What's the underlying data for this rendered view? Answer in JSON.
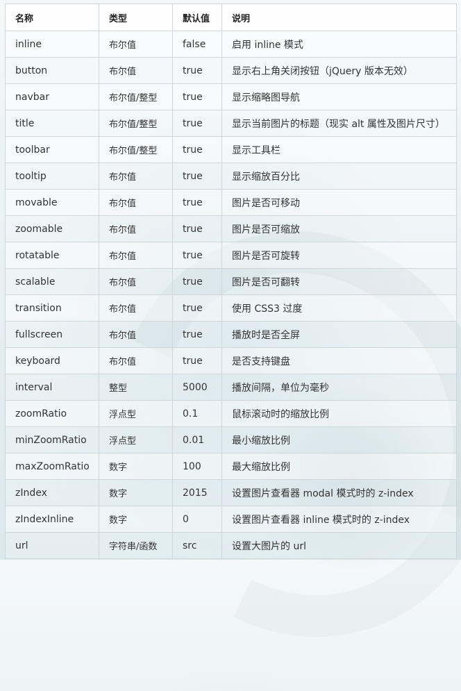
{
  "table": {
    "headers": [
      "名称",
      "类型",
      "默认值",
      "说明"
    ],
    "rows": [
      [
        "inline",
        "布尔值",
        "false",
        "启用 inline 模式"
      ],
      [
        "button",
        "布尔值",
        "true",
        "显示右上角关闭按钮（jQuery 版本无效）"
      ],
      [
        "navbar",
        "布尔值/整型",
        "true",
        "显示缩略图导航"
      ],
      [
        "title",
        "布尔值/整型",
        "true",
        "显示当前图片的标题（现实 alt 属性及图片尺寸）"
      ],
      [
        "toolbar",
        "布尔值/整型",
        "true",
        "显示工具栏"
      ],
      [
        "tooltip",
        "布尔值",
        "true",
        "显示缩放百分比"
      ],
      [
        "movable",
        "布尔值",
        "true",
        "图片是否可移动"
      ],
      [
        "zoomable",
        "布尔值",
        "true",
        "图片是否可缩放"
      ],
      [
        "rotatable",
        "布尔值",
        "true",
        "图片是否可旋转"
      ],
      [
        "scalable",
        "布尔值",
        "true",
        "图片是否可翻转"
      ],
      [
        "transition",
        "布尔值",
        "true",
        "使用 CSS3 过度"
      ],
      [
        "fullscreen",
        "布尔值",
        "true",
        "播放时是否全屏"
      ],
      [
        "keyboard",
        "布尔值",
        "true",
        "是否支持键盘"
      ],
      [
        "interval",
        "整型",
        "5000",
        "播放间隔，单位为毫秒"
      ],
      [
        "zoomRatio",
        "浮点型",
        "0.1",
        "鼠标滚动时的缩放比例"
      ],
      [
        "minZoomRatio",
        "浮点型",
        "0.01",
        "最小缩放比例"
      ],
      [
        "maxZoomRatio",
        "数字",
        "100",
        "最大缩放比例"
      ],
      [
        "zIndex",
        "数字",
        "2015",
        "设置图片查看器 modal 模式时的 z-index"
      ],
      [
        "zIndexInline",
        "数字",
        "0",
        "设置图片查看器 inline 模式时的 z-index"
      ],
      [
        "url",
        "字符串/函数",
        "src",
        "设置大图片的 url"
      ]
    ]
  }
}
